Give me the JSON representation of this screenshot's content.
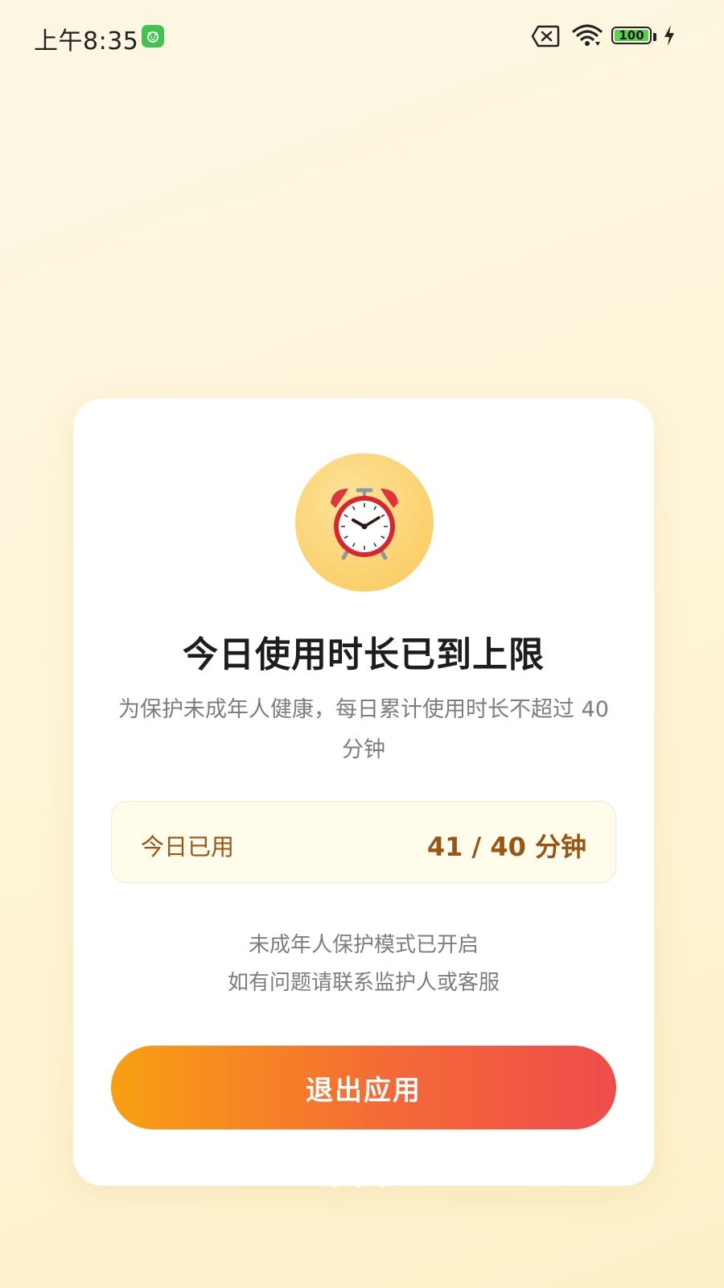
{
  "status_bar": {
    "time": "上午8:35",
    "app_icon": "notification-app-icon",
    "battery_level": "100",
    "icons": [
      "sim-disabled-icon",
      "wifi-icon",
      "battery-icon",
      "charging-bolt-icon"
    ],
    "colors": {
      "app_badge": "#43c24f",
      "battery_fill": "#5bd04e"
    }
  },
  "dialog": {
    "icon": "alarm-clock-icon",
    "title": "今日使用时长已到上限",
    "subtitle": "为保护未成年人健康，每日累计使用时长不超过 40 分钟",
    "usage": {
      "label": "今日已用",
      "value": "41 / 40 分钟"
    },
    "notes": {
      "line1": "未成年人保护模式已开启",
      "line2": "如有问题请联系监护人或客服"
    },
    "exit_button_label": "退出应用",
    "colors": {
      "accent_text": "#9a5414",
      "button_start": "#f9a012",
      "button_end": "#f04c4c",
      "icon_circle": "#fbd06c"
    }
  }
}
